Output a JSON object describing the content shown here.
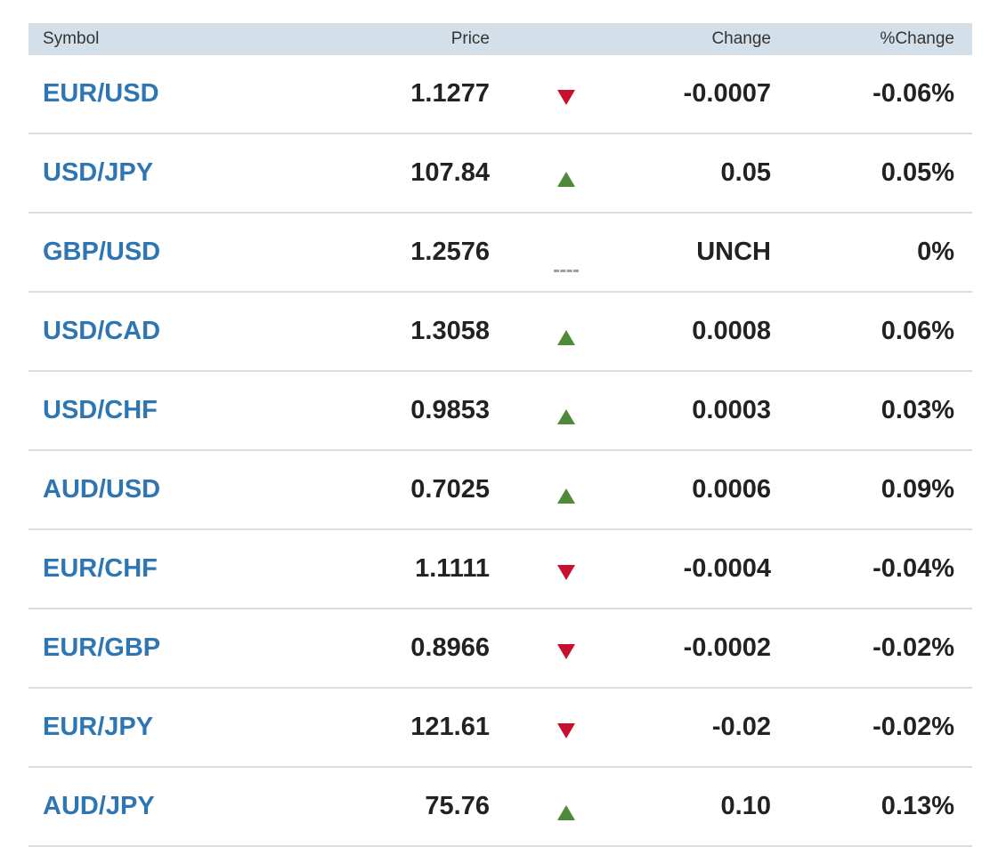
{
  "header": {
    "symbol": "Symbol",
    "price": "Price",
    "change": "Change",
    "pct_change": "%Change"
  },
  "colors": {
    "header_bg": "#d3e0ea",
    "symbol_link": "#2d76b3",
    "down": "#c8102e",
    "up": "#4f8a3a",
    "unchanged": "#9aa3ab"
  },
  "rows": [
    {
      "symbol": "EUR/USD",
      "price": "1.1277",
      "direction": "down",
      "change": "-0.0007",
      "pct_change": "-0.06%"
    },
    {
      "symbol": "USD/JPY",
      "price": "107.84",
      "direction": "up",
      "change": "0.05",
      "pct_change": "0.05%"
    },
    {
      "symbol": "GBP/USD",
      "price": "1.2576",
      "direction": "flat",
      "change": "UNCH",
      "pct_change": "0%"
    },
    {
      "symbol": "USD/CAD",
      "price": "1.3058",
      "direction": "up",
      "change": "0.0008",
      "pct_change": "0.06%"
    },
    {
      "symbol": "USD/CHF",
      "price": "0.9853",
      "direction": "up",
      "change": "0.0003",
      "pct_change": "0.03%"
    },
    {
      "symbol": "AUD/USD",
      "price": "0.7025",
      "direction": "up",
      "change": "0.0006",
      "pct_change": "0.09%"
    },
    {
      "symbol": "EUR/CHF",
      "price": "1.1111",
      "direction": "down",
      "change": "-0.0004",
      "pct_change": "-0.04%"
    },
    {
      "symbol": "EUR/GBP",
      "price": "0.8966",
      "direction": "down",
      "change": "-0.0002",
      "pct_change": "-0.02%"
    },
    {
      "symbol": "EUR/JPY",
      "price": "121.61",
      "direction": "down",
      "change": "-0.02",
      "pct_change": "-0.02%"
    },
    {
      "symbol": "AUD/JPY",
      "price": "75.76",
      "direction": "up",
      "change": "0.10",
      "pct_change": "0.13%"
    }
  ]
}
